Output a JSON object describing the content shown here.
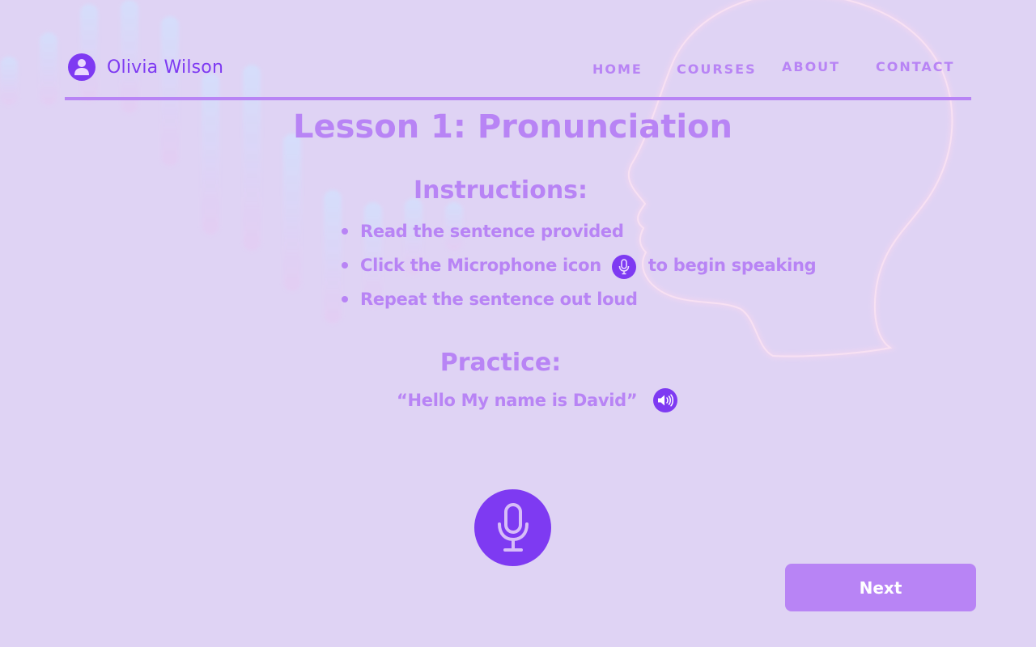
{
  "header": {
    "user_name": "Olivia Wilson",
    "avatar_icon": "user-icon",
    "nav": [
      "HOME",
      "COURSES",
      "ABOUT",
      "CONTACT"
    ]
  },
  "lesson": {
    "title": "Lesson 1: Pronunciation"
  },
  "instructions": {
    "heading": "Instructions:",
    "items": [
      "Read the sentence provided",
      "Click the Microphone icon",
      "to begin speaking",
      "Repeat the sentence out loud"
    ],
    "inline_icon": "microphone-icon"
  },
  "practice": {
    "heading": "Practice:",
    "sentence": "“Hello My name is David”",
    "play_icon": "speaker-icon"
  },
  "record": {
    "icon": "microphone-icon"
  },
  "next_label": "Next",
  "colors": {
    "background": "#dfd3f4",
    "accent": "#7e3af2",
    "soft_accent": "#b884f5"
  }
}
